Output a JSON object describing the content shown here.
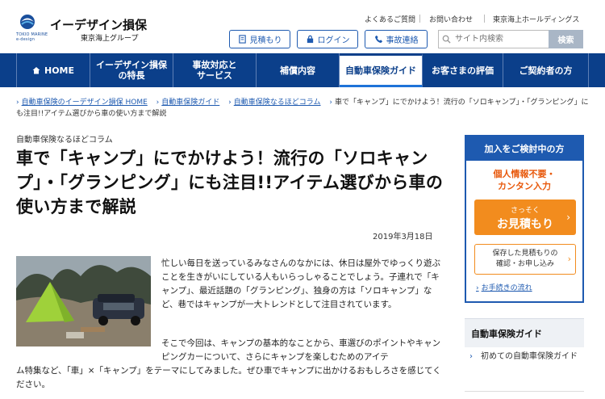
{
  "header": {
    "logo_sub": "TOKIO MARINE\ne-design",
    "brand": "イーデザイン損保",
    "brand_sub": "東京海上グループ",
    "util_links": [
      "よくあるご質問",
      "お問い合わせ",
      "東京海上ホールディングス"
    ],
    "buttons": {
      "quote": "見積もり",
      "login": "ログイン",
      "accident": "事故連絡"
    },
    "search_placeholder": "サイト内検索",
    "search_button": "検索"
  },
  "nav": {
    "items": [
      "HOME",
      "イーデザイン損保\nの特長",
      "事故対応と\nサービス",
      "補償内容",
      "自動車保険ガイド",
      "お客さまの評価",
      "ご契約者の方"
    ],
    "active_index": 4
  },
  "breadcrumb": {
    "items": [
      "自動車保険のイーデザイン損保 HOME",
      "自動車保険ガイド",
      "自動車保険なるほどコラム"
    ],
    "current": "車で「キャンプ」にでかけよう！流行の「ソロキャンプ」・「グランピング」にも注目!!アイテム選びから車の使い方まで解説"
  },
  "article": {
    "kicker": "自動車保険なるほどコラム",
    "title": "車で「キャンプ」にでかけよう！流行の「ソロキャンプ」・「グランピング」にも注目!!アイテム選びから車の使い方まで解説",
    "date": "2019年3月18日",
    "p1": "忙しい毎日を送っているみなさんのなかには、休日は屋外でゆっくり遊ぶことを生きがいにしている人もいらっしゃることでしょう。子連れで「キャンプ」、最近話題の「グランピング」、独身の方は「ソロキャンプ」など、巷ではキャンプが一大トレンドとして注目されています。",
    "p2a": "そこで今回は、キャンプの基本的なことから、車選びのポイントやキャンピングカーについて、さらにキャンプを楽しむための",
    "p2a_tail": "アイテ",
    "p2b": "ム特集など、「車」×「キャンプ」をテーマにしてみました。ぜひ車でキャンプに出かけるおもしろさを感じてください。"
  },
  "sidebar": {
    "box_head": "加入をご検討中の方",
    "warning": "個人情報不要・\nカンタン入力",
    "quote_small": "さっそく",
    "quote_big": "お見積もり",
    "saved": "保存した見積もりの\n確認・お申し込み",
    "flow": "お手続きの流れ",
    "guide_head": "自動車保険ガイド",
    "guide_item": "初めての自動車保険ガイド"
  },
  "colors": {
    "navy": "#0b3f8a",
    "blue": "#1e5ab0",
    "orange": "#f28c1e",
    "warn": "#e8590c"
  }
}
